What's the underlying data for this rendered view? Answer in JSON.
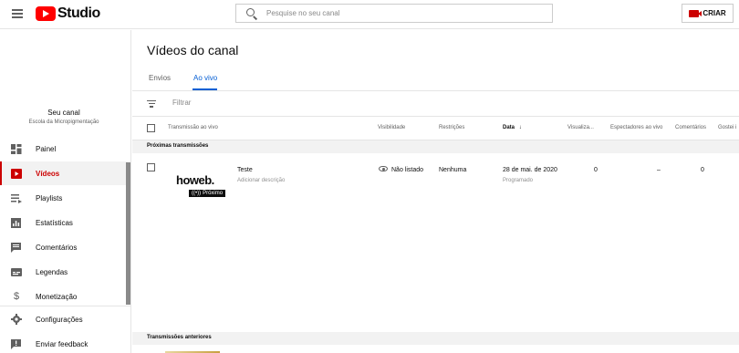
{
  "header": {
    "logo_text": "Studio",
    "search_placeholder": "Pesquise no seu canal",
    "create_label": "CRIAR"
  },
  "sidebar": {
    "channel_label": "Seu canal",
    "channel_name": "Escola da Micropigmentação",
    "items": [
      {
        "label": "Painel",
        "icon": "dashboard-icon"
      },
      {
        "label": "Vídeos",
        "icon": "videos-icon",
        "active": true
      },
      {
        "label": "Playlists",
        "icon": "playlists-icon"
      },
      {
        "label": "Estatísticas",
        "icon": "analytics-icon"
      },
      {
        "label": "Comentários",
        "icon": "comments-icon"
      },
      {
        "label": "Legendas",
        "icon": "subtitles-icon"
      },
      {
        "label": "Monetização",
        "icon": "monetization-icon"
      },
      {
        "label": "Configurações",
        "icon": "settings-icon"
      },
      {
        "label": "Enviar feedback",
        "icon": "feedback-icon"
      }
    ]
  },
  "main": {
    "title": "Vídeos do canal",
    "tabs": [
      {
        "label": "Envios",
        "active": false
      },
      {
        "label": "Ao vivo",
        "active": true
      }
    ],
    "filter_placeholder": "Filtrar",
    "columns": {
      "video": "Transmissão ao vivo",
      "visibility": "Visibilidade",
      "restrictions": "Restrições",
      "date": "Data",
      "views": "Visualiza...",
      "viewers": "Espectadores ao vivo",
      "comments": "Comentários",
      "likes": "Gostei i"
    },
    "upcoming_section": "Próximas transmissões",
    "past_section": "Transmissões anteriores",
    "rows": [
      {
        "thumb_logo_a": "ho",
        "thumb_logo_b": "w",
        "thumb_logo_c": "eb.",
        "thumb_badge": "Próximo",
        "title": "Teste",
        "description": "Adicionar descrição",
        "visibility": "Não listado",
        "restrictions": "Nenhuma",
        "date": "28 de mai. de 2020",
        "date_status": "Programado",
        "views": "0",
        "viewers": "–",
        "comments": "0"
      }
    ]
  },
  "colors": {
    "brand_red": "#ff0000",
    "active_red": "#cc0000",
    "tab_blue": "#065fd4"
  }
}
